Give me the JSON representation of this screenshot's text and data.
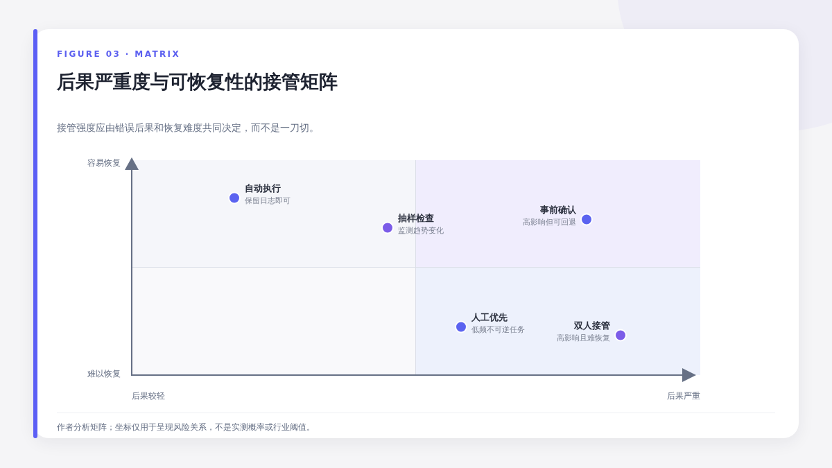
{
  "eyebrow": "FIGURE 03 · MATRIX",
  "title": "后果严重度与可恢复性的接管矩阵",
  "subtitle": "接管强度应由错误后果和恢复难度共同决定，而不是一刀切。",
  "matrix": {
    "y_top_label": "容易恢复",
    "y_bottom_label": "难以恢复",
    "x_left_label": "后果较轻",
    "x_right_label": "后果严重",
    "points": [
      {
        "title": "自动执行",
        "note": "保留日志即可",
        "color": "#5b63f0"
      },
      {
        "title": "抽样检查",
        "note": "监测趋势变化",
        "color": "#7b5ce8"
      },
      {
        "title": "事前确认",
        "note": "高影响但可回退",
        "color": "#5b63f0"
      },
      {
        "title": "人工优先",
        "note": "低频不可逆任务",
        "color": "#5b63f0"
      },
      {
        "title": "双人接管",
        "note": "高影响且难恢复",
        "color": "#7b5ce8"
      }
    ]
  },
  "footnote": "作者分析矩阵；坐标仅用于呈现风险关系，不是实测概率或行业阈值。"
}
